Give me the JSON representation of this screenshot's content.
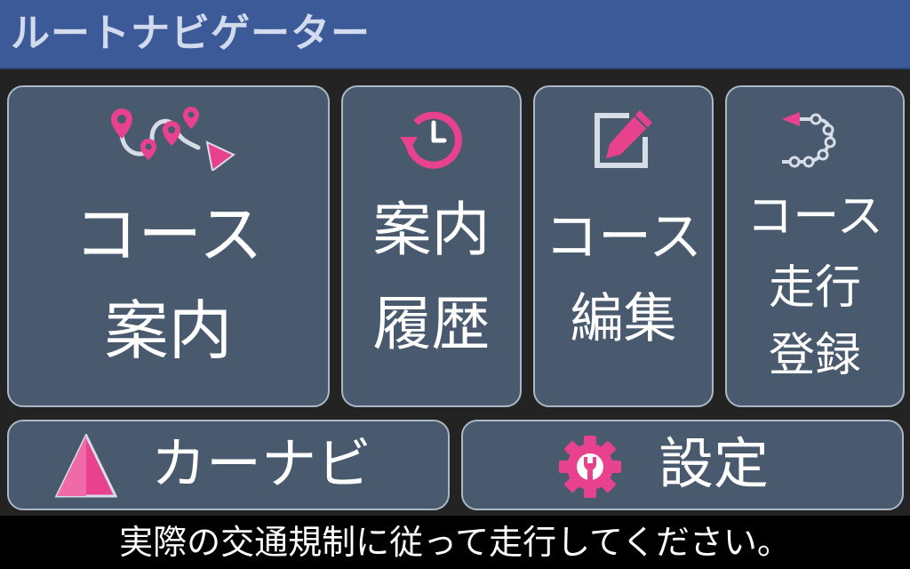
{
  "header": {
    "title": "ルートナビゲーター"
  },
  "menu": {
    "course_guide": {
      "line1": "コース",
      "line2": "案内",
      "icon": "route-map-icon"
    },
    "guide_history": {
      "line1": "案内",
      "line2": "履歴",
      "icon": "history-clock-icon"
    },
    "course_edit": {
      "line1": "コース",
      "line2": "編集",
      "icon": "edit-pencil-icon"
    },
    "course_record": {
      "line1": "コース",
      "line2": "走行",
      "line3": "登録",
      "icon": "track-record-icon"
    },
    "car_navi": {
      "label": "カーナビ",
      "icon": "navigation-arrow-icon"
    },
    "settings": {
      "label": "設定",
      "icon": "gear-wrench-icon"
    }
  },
  "footer": {
    "message": "実際の交通規制に従って走行してください。"
  },
  "colors": {
    "accent": "#e8418e",
    "header_bg": "#3d5a98",
    "tile_bg": "#4a5a6e",
    "tile_border": "#aab8c6",
    "background": "#232323"
  }
}
